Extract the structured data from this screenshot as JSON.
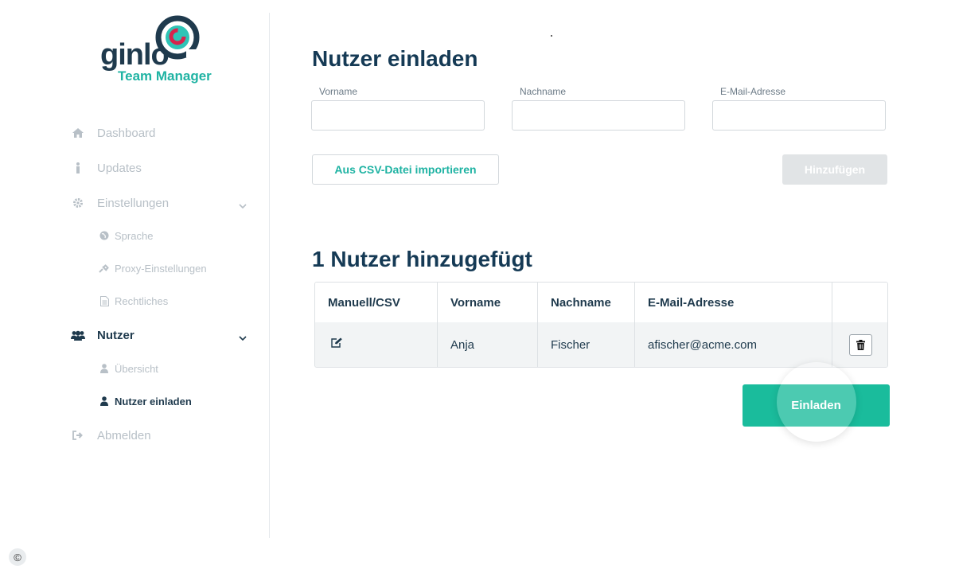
{
  "brand": {
    "name": "ginlo",
    "product": "Team Manager",
    "colors": {
      "primary_dark": "#1f3a4d",
      "accent": "#1fb3a3",
      "brand_red": "#d8234c",
      "button_primary": "#1abc9c"
    }
  },
  "sidebar": {
    "items": [
      {
        "label": "Dashboard",
        "icon": "home-icon"
      },
      {
        "label": "Updates",
        "icon": "info-icon"
      },
      {
        "label": "Einstellungen",
        "icon": "gear-icon",
        "expanded": true,
        "children": [
          {
            "label": "Sprache",
            "icon": "globe-icon"
          },
          {
            "label": "Proxy-Einstellungen",
            "icon": "plug-icon"
          },
          {
            "label": "Rechtliches",
            "icon": "document-icon"
          }
        ]
      },
      {
        "label": "Nutzer",
        "icon": "users-icon",
        "active": true,
        "expanded": true,
        "children": [
          {
            "label": "Übersicht",
            "icon": "user-icon"
          },
          {
            "label": "Nutzer einladen",
            "icon": "user-icon",
            "active": true
          }
        ]
      },
      {
        "label": "Abmelden",
        "icon": "logout-icon"
      }
    ]
  },
  "main": {
    "title": "Nutzer einladen",
    "form": {
      "first_name": {
        "label": "Vorname",
        "value": ""
      },
      "last_name": {
        "label": "Nachname",
        "value": ""
      },
      "email": {
        "label": "E-Mail-Adresse",
        "value": ""
      }
    },
    "import_button": "Aus CSV-Datei importieren",
    "add_button": "Hinzufügen",
    "added_title": "1 Nutzer hinzugefügt",
    "table": {
      "columns": [
        "Manuell/CSV",
        "Vorname",
        "Nachname",
        "E-Mail-Adresse",
        ""
      ],
      "rows": [
        {
          "source_icon": "edit-icon",
          "first_name": "Anja",
          "last_name": "Fischer",
          "email": "afischer@acme.com",
          "action_icon": "trash-icon"
        }
      ]
    },
    "invite_button": "Einladen"
  },
  "footer": {
    "copyright_symbol": "©"
  }
}
